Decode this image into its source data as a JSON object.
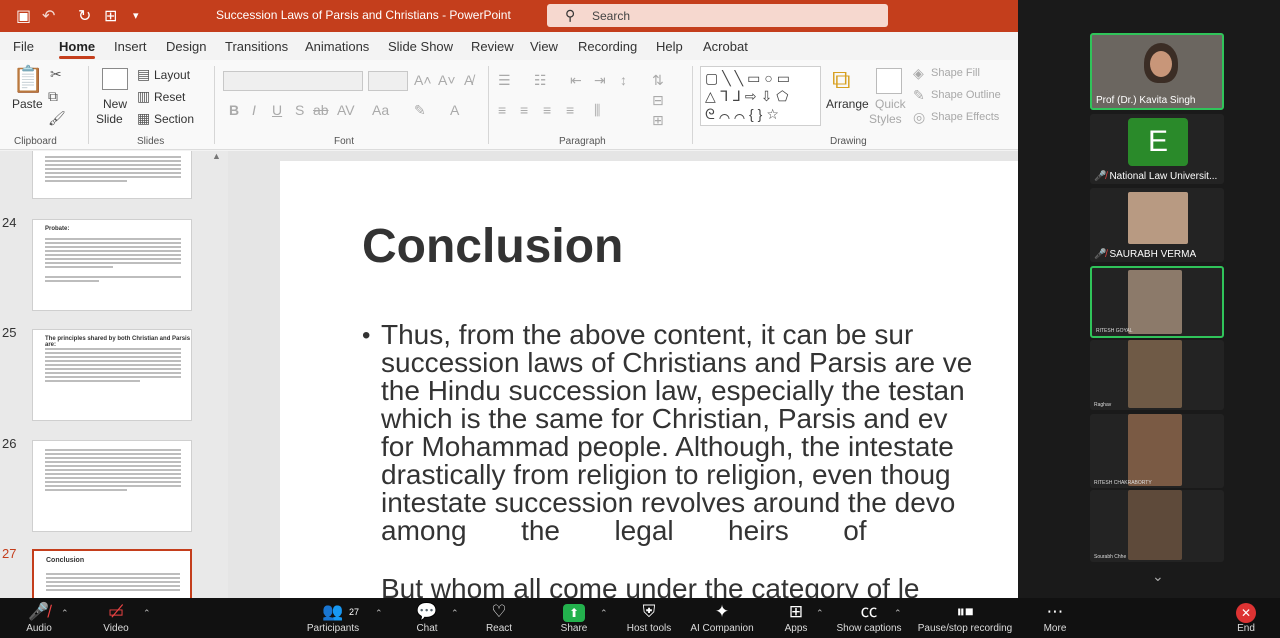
{
  "ppt": {
    "title": "Succession Laws of Parsis and Christians  -  PowerPoint",
    "search_placeholder": "Search",
    "menu": [
      "File",
      "Home",
      "Insert",
      "Design",
      "Transitions",
      "Animations",
      "Slide Show",
      "Review",
      "View",
      "Recording",
      "Help",
      "Acrobat"
    ],
    "ribbon": {
      "paste": "Paste",
      "new_slide": "New",
      "slide_label": "Slide",
      "layout": "Layout",
      "reset": "Reset",
      "section": "Section",
      "arrange": "Arrange",
      "quick_styles_1": "Quick",
      "quick_styles_2": "Styles",
      "shape_fill": "Shape Fill",
      "shape_outline": "Shape Outline",
      "shape_effects": "Shape Effects",
      "groups": {
        "clipboard": "Clipboard",
        "slides": "Slides",
        "font": "Font",
        "paragraph": "Paragraph",
        "drawing": "Drawing"
      }
    },
    "thumbnails": [
      {
        "num": "24",
        "title": "Probate:"
      },
      {
        "num": "25",
        "title": "The principles shared by both Christian and Parsis are:"
      },
      {
        "num": "26",
        "title": ""
      },
      {
        "num": "27",
        "title": "Conclusion"
      }
    ],
    "slide": {
      "title": "Conclusion",
      "bullet": "•",
      "lines": [
        "Thus, from the above content, it can be sur",
        "succession laws of Christians and Parsis are ve",
        "the Hindu succession law, especially the testan",
        "which is the same for Christian, Parsis and ev",
        "for Mohammad people. Although, the intestate",
        "drastically from religion to religion, even thoug",
        "intestate succession revolves around the devo",
        "among       the       legal       heirs       of"
      ],
      "trailing": "But whom all come under the category of le"
    }
  },
  "zoom": {
    "participants": [
      {
        "name": "Prof (Dr.) Kavita Singh",
        "muted": false
      },
      {
        "name": "National Law Universit...",
        "initial": "E",
        "muted": true
      },
      {
        "name": "SAURABH VERMA",
        "muted": true
      },
      {
        "name": "RITESH GOYAL",
        "muted": false
      },
      {
        "name": "Raghav",
        "muted": true
      },
      {
        "name": "RITESH CHAKRABORTY",
        "muted": true
      },
      {
        "name": "Sourabh Chhe",
        "muted": false
      }
    ],
    "toolbar": {
      "audio": "Audio",
      "video": "Video",
      "participants": "Participants",
      "participants_count": "27",
      "chat": "Chat",
      "react": "React",
      "share": "Share",
      "host_tools": "Host tools",
      "ai_companion": "AI Companion",
      "apps": "Apps",
      "show_captions": "Show captions",
      "pause_recording": "Pause/stop recording",
      "more": "More",
      "end": "End"
    },
    "colors": {
      "active_speaker": "#30c45a",
      "end": "#dd3333",
      "share": "#23b14d",
      "ppt_accent": "#c43e1c"
    }
  }
}
